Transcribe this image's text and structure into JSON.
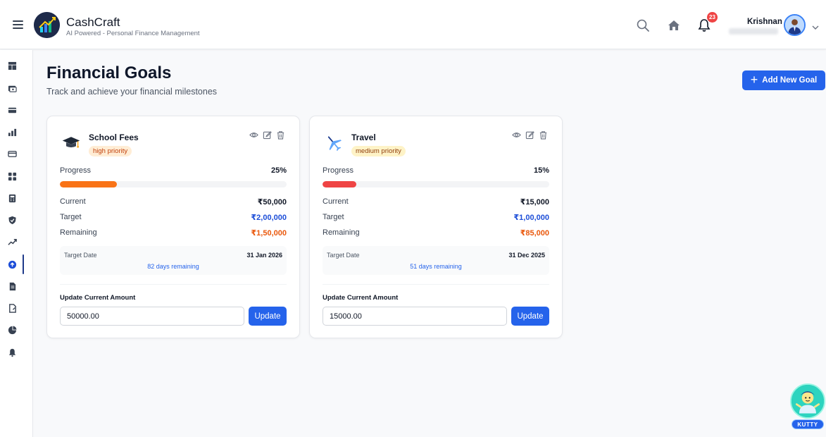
{
  "app": {
    "name": "CashCraft",
    "tagline": "AI Powered - Personal Finance Management",
    "notifications_count": "23",
    "user_name": "Krishnan"
  },
  "sidebar": {
    "items": [
      {
        "icon": "dashboard-icon"
      },
      {
        "icon": "wallet-icon"
      },
      {
        "icon": "card-icon"
      },
      {
        "icon": "bar-chart-icon"
      },
      {
        "icon": "credit-card-icon"
      },
      {
        "icon": "grid-icon"
      },
      {
        "icon": "calculator-icon"
      },
      {
        "icon": "shield-icon"
      },
      {
        "icon": "trending-up-icon"
      },
      {
        "icon": "goals-icon",
        "active": true
      },
      {
        "icon": "document-icon"
      },
      {
        "icon": "file-icon"
      },
      {
        "icon": "pie-chart-icon"
      },
      {
        "icon": "bell-icon"
      }
    ]
  },
  "page": {
    "title": "Financial Goals",
    "subtitle": "Track and achieve your financial milestones",
    "add_button": "Add New Goal"
  },
  "labels": {
    "progress": "Progress",
    "current": "Current",
    "target": "Target",
    "remaining": "Remaining",
    "target_date": "Target Date",
    "update_amount": "Update Current Amount",
    "update_button": "Update"
  },
  "goals": [
    {
      "title": "School Fees",
      "priority": "high priority",
      "progress_text": "25%",
      "progress": 0.25,
      "progress_color": "#f97316",
      "current": "₹50,000",
      "target": "₹2,00,000",
      "remaining": "₹1,50,000",
      "target_date": "31 Jan 2026",
      "days_remaining": "82 days remaining",
      "input_value": "50000.00"
    },
    {
      "title": "Travel",
      "priority": "medium priority",
      "progress_text": "15%",
      "progress": 0.15,
      "progress_color": "#ef4444",
      "current": "₹15,000",
      "target": "₹1,00,000",
      "remaining": "₹85,000",
      "target_date": "31 Dec 2025",
      "days_remaining": "51 days remaining",
      "input_value": "15000.00"
    }
  ],
  "assistant": {
    "label": "KUTTY"
  },
  "colors": {
    "accent": "#2563eb",
    "orange": "#ea580c",
    "blue_value": "#1d4ed8"
  }
}
